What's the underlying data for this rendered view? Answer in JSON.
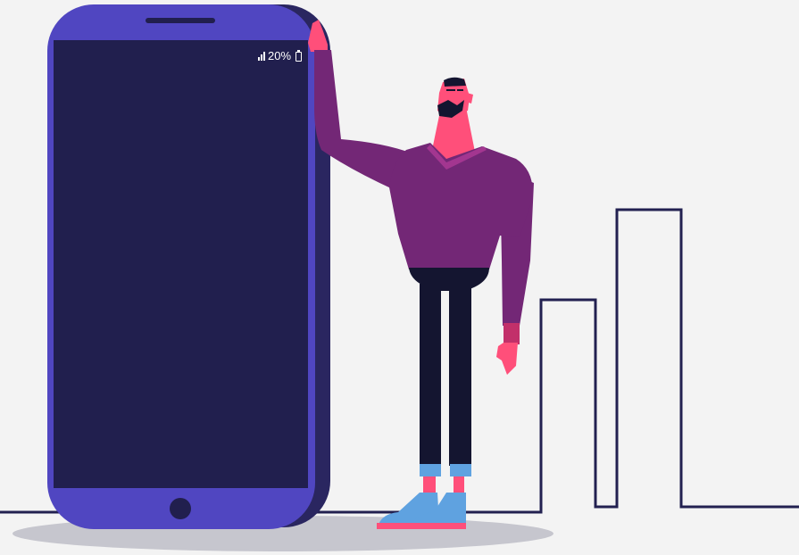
{
  "status": {
    "battery_percent": "20%",
    "signal_icon": "signal-bars-icon",
    "battery_icon": "battery-low-icon"
  },
  "colors": {
    "background": "#f3f3f3",
    "phone_body": "#5046c1",
    "phone_shadow": "#2a2660",
    "phone_screen": "#211f4e",
    "sweater": "#732776",
    "skin": "#ff4f7a",
    "pants": "#141530",
    "sneakers": "#5fa2e0",
    "skyline": "#222050",
    "floor_shadow": "#c6c6ce"
  }
}
